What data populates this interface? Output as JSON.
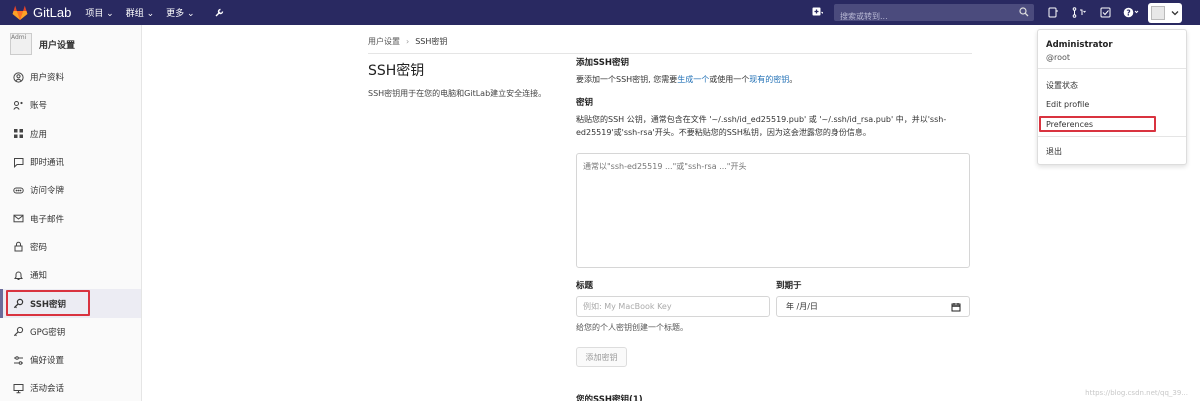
{
  "navbar": {
    "brand": "GitLab",
    "menu": [
      {
        "label": "项目 ⌄"
      },
      {
        "label": "群组 ⌄"
      },
      {
        "label": "更多 ⌄"
      }
    ],
    "search_placeholder": "搜索或转到...",
    "bg_color": "#292961"
  },
  "sidebar": {
    "title": "用户设置",
    "avatar_alt": "Admi",
    "items": [
      {
        "label": "用户资料",
        "icon": "profile-icon"
      },
      {
        "label": "账号",
        "icon": "account-icon"
      },
      {
        "label": "应用",
        "icon": "applications-icon"
      },
      {
        "label": "即时通讯",
        "icon": "chat-icon"
      },
      {
        "label": "访问令牌",
        "icon": "token-icon"
      },
      {
        "label": "电子邮件",
        "icon": "mail-icon"
      },
      {
        "label": "密码",
        "icon": "lock-icon"
      },
      {
        "label": "通知",
        "icon": "bell-icon"
      },
      {
        "label": "SSH密钥",
        "icon": "key-icon",
        "active": true
      },
      {
        "label": "GPG密钥",
        "icon": "gpg-key-icon"
      },
      {
        "label": "偏好设置",
        "icon": "preferences-icon"
      },
      {
        "label": "活动会话",
        "icon": "monitor-icon"
      }
    ]
  },
  "breadcrumb": {
    "parent": "用户设置",
    "current": "SSH密钥"
  },
  "left": {
    "title": "SSH密钥",
    "description": "SSH密钥用于在您的电脑和GitLab建立安全连接。"
  },
  "form": {
    "add_heading": "添加SSH密钥",
    "intro_prefix": "要添加一个SSH密钥, 您需要",
    "intro_link1": "生成一个",
    "intro_mid": "或使用一个",
    "intro_link2": "现有的密钥",
    "intro_suffix": "。",
    "key_label": "密钥",
    "key_help": "粘贴您的SSH 公钥，通常包含在文件 '~/.ssh/id_ed25519.pub' 或 '~/.ssh/id_rsa.pub' 中，并以'ssh-ed25519'或'ssh-rsa'开头。不要粘贴您的SSH私钥，因为这会泄露您的身份信息。",
    "key_placeholder": "通常以\"ssh-ed25519 ...\"或\"ssh-rsa ...\"开头",
    "title_label": "标题",
    "title_placeholder": "例如: My MacBook Key",
    "expires_label": "到期于",
    "date_value": "年 /月/日",
    "title_hint": "给您的个人密钥创建一个标题。",
    "add_button": "添加密钥",
    "next_section_cut": "您的SSH密钥(1)"
  },
  "dropdown": {
    "name": "Administrator",
    "handle": "@root",
    "items": [
      {
        "label": "设置状态"
      },
      {
        "label": "Edit profile"
      },
      {
        "label": "Preferences",
        "highlighted": true
      },
      {
        "label": "退出"
      }
    ]
  },
  "watermark": "https://blog.csdn.net/qq_39..."
}
